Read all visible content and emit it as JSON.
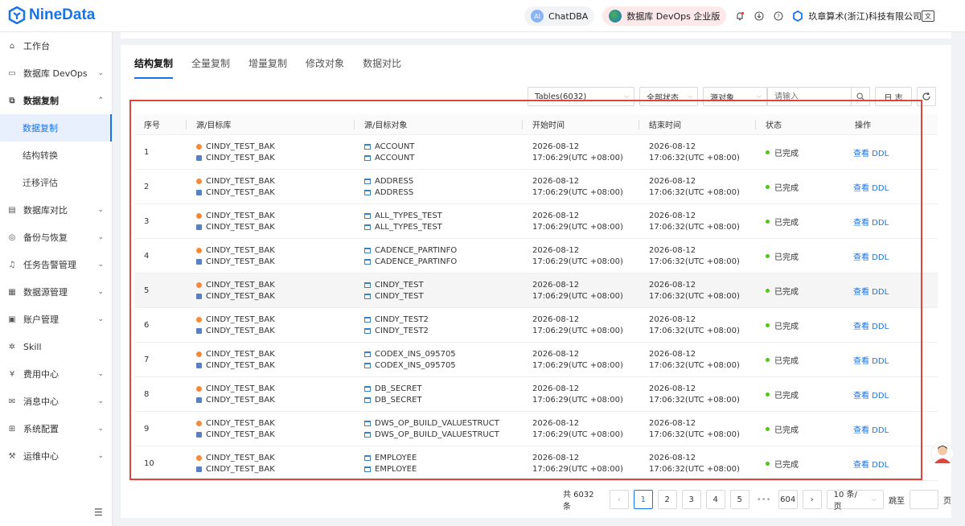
{
  "app": {
    "logo_text": "NineData"
  },
  "topbar": {
    "chatdba": "ChatDBA",
    "ai_badge": "AI",
    "devops_edition": "数据库 DevOps 企业版",
    "company": "玖章算术(浙江)科技有限公司"
  },
  "sidebar": {
    "items": [
      {
        "label": "工作台",
        "icon": "home-icon",
        "has_children": false
      },
      {
        "label": "数据库 DevOps",
        "icon": "monitor-icon",
        "has_children": true
      },
      {
        "label": "数据复制",
        "icon": "copy-icon",
        "has_children": true,
        "expanded": true
      },
      {
        "label": "数据库对比",
        "icon": "compare-icon",
        "has_children": true
      },
      {
        "label": "备份与恢复",
        "icon": "backup-icon",
        "has_children": true
      },
      {
        "label": "任务告警管理",
        "icon": "alarm-icon",
        "has_children": true
      },
      {
        "label": "数据源管理",
        "icon": "datasource-icon",
        "has_children": true
      },
      {
        "label": "账户管理",
        "icon": "account-icon",
        "has_children": true
      },
      {
        "label": "Skill",
        "icon": "skill-icon",
        "has_children": false
      },
      {
        "label": "费用中心",
        "icon": "fee-icon",
        "has_children": true
      },
      {
        "label": "消息中心",
        "icon": "mail-icon",
        "has_children": true
      },
      {
        "label": "系统配置",
        "icon": "grid-icon",
        "has_children": true
      },
      {
        "label": "运维中心",
        "icon": "wrench-icon",
        "has_children": true
      }
    ],
    "sub_items": [
      "数据复制",
      "结构转换",
      "迁移评估"
    ],
    "active_sub": "数据复制"
  },
  "tabs": [
    "结构复制",
    "全量复制",
    "增量复制",
    "修改对象",
    "数据对比"
  ],
  "active_tab": "结构复制",
  "filters": {
    "tables": "Tables(6032)",
    "status": "全部状态",
    "object": "源对象",
    "search_placeholder": "请输入",
    "log_button": "日 志"
  },
  "table": {
    "columns": [
      "序号",
      "源/目标库",
      "源/目标对象",
      "开始时间",
      "结束时间",
      "状态",
      "操作"
    ],
    "rows": [
      {
        "no": "1",
        "src_db": "CINDY_TEST_BAK",
        "dst_db": "CINDY_TEST_BAK",
        "src_obj": "ACCOUNT",
        "dst_obj": "ACCOUNT",
        "start_date": "2026-08-12",
        "start_time": "17:06:29(UTC +08:00)",
        "end_date": "2026-08-12",
        "end_time": "17:06:32(UTC +08:00)",
        "status": "已完成",
        "action": "查看 DDL"
      },
      {
        "no": "2",
        "src_db": "CINDY_TEST_BAK",
        "dst_db": "CINDY_TEST_BAK",
        "src_obj": "ADDRESS",
        "dst_obj": "ADDRESS",
        "start_date": "2026-08-12",
        "start_time": "17:06:29(UTC +08:00)",
        "end_date": "2026-08-12",
        "end_time": "17:06:32(UTC +08:00)",
        "status": "已完成",
        "action": "查看 DDL"
      },
      {
        "no": "3",
        "src_db": "CINDY_TEST_BAK",
        "dst_db": "CINDY_TEST_BAK",
        "src_obj": "ALL_TYPES_TEST",
        "dst_obj": "ALL_TYPES_TEST",
        "start_date": "2026-08-12",
        "start_time": "17:06:29(UTC +08:00)",
        "end_date": "2026-08-12",
        "end_time": "17:06:32(UTC +08:00)",
        "status": "已完成",
        "action": "查看 DDL"
      },
      {
        "no": "4",
        "src_db": "CINDY_TEST_BAK",
        "dst_db": "CINDY_TEST_BAK",
        "src_obj": "CADENCE_PARTINFO",
        "dst_obj": "CADENCE_PARTINFO",
        "start_date": "2026-08-12",
        "start_time": "17:06:29(UTC +08:00)",
        "end_date": "2026-08-12",
        "end_time": "17:06:32(UTC +08:00)",
        "status": "已完成",
        "action": "查看 DDL"
      },
      {
        "no": "5",
        "src_db": "CINDY_TEST_BAK",
        "dst_db": "CINDY_TEST_BAK",
        "src_obj": "CINDY_TEST",
        "dst_obj": "CINDY_TEST",
        "start_date": "2026-08-12",
        "start_time": "17:06:29(UTC +08:00)",
        "end_date": "2026-08-12",
        "end_time": "17:06:32(UTC +08:00)",
        "status": "已完成",
        "action": "查看 DDL"
      },
      {
        "no": "6",
        "src_db": "CINDY_TEST_BAK",
        "dst_db": "CINDY_TEST_BAK",
        "src_obj": "CINDY_TEST2",
        "dst_obj": "CINDY_TEST2",
        "start_date": "2026-08-12",
        "start_time": "17:06:29(UTC +08:00)",
        "end_date": "2026-08-12",
        "end_time": "17:06:32(UTC +08:00)",
        "status": "已完成",
        "action": "查看 DDL"
      },
      {
        "no": "7",
        "src_db": "CINDY_TEST_BAK",
        "dst_db": "CINDY_TEST_BAK",
        "src_obj": "CODEX_INS_095705",
        "dst_obj": "CODEX_INS_095705",
        "start_date": "2026-08-12",
        "start_time": "17:06:29(UTC +08:00)",
        "end_date": "2026-08-12",
        "end_time": "17:06:32(UTC +08:00)",
        "status": "已完成",
        "action": "查看 DDL"
      },
      {
        "no": "8",
        "src_db": "CINDY_TEST_BAK",
        "dst_db": "CINDY_TEST_BAK",
        "src_obj": "DB_SECRET",
        "dst_obj": "DB_SECRET",
        "start_date": "2026-08-12",
        "start_time": "17:06:29(UTC +08:00)",
        "end_date": "2026-08-12",
        "end_time": "17:06:32(UTC +08:00)",
        "status": "已完成",
        "action": "查看 DDL"
      },
      {
        "no": "9",
        "src_db": "CINDY_TEST_BAK",
        "dst_db": "CINDY_TEST_BAK",
        "src_obj": "DWS_OP_BUILD_VALUESTRUCT",
        "dst_obj": "DWS_OP_BUILD_VALUESTRUCT",
        "start_date": "2026-08-12",
        "start_time": "17:06:29(UTC +08:00)",
        "end_date": "2026-08-12",
        "end_time": "17:06:32(UTC +08:00)",
        "status": "已完成",
        "action": "查看 DDL"
      },
      {
        "no": "10",
        "src_db": "CINDY_TEST_BAK",
        "dst_db": "CINDY_TEST_BAK",
        "src_obj": "EMPLOYEE",
        "dst_obj": "EMPLOYEE",
        "start_date": "2026-08-12",
        "start_time": "17:06:29(UTC +08:00)",
        "end_date": "2026-08-12",
        "end_time": "17:06:32(UTC +08:00)",
        "status": "已完成",
        "action": "查看 DDL"
      }
    ]
  },
  "pagination": {
    "total": "共 6032 条",
    "pages": [
      "1",
      "2",
      "3",
      "4",
      "5"
    ],
    "ellipsis": "•••",
    "last_page": "604",
    "current": "1",
    "page_size": "10 条/页",
    "jump_label": "跳至",
    "page_suffix": "页"
  },
  "colors": {
    "accent": "#1a73e8",
    "success": "#52c41a",
    "highlight_box": "#e0453d"
  }
}
